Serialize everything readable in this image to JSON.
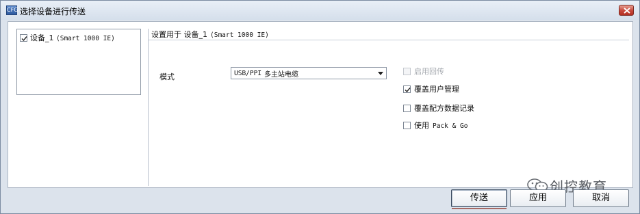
{
  "window": {
    "title": "选择设备进行传送",
    "app_icon_text": "CFG"
  },
  "device_list": {
    "items": [
      {
        "name": "设备_1",
        "type": "(Smart 1000 IE)",
        "checked": true
      }
    ]
  },
  "settings": {
    "group_title_prefix": "设置用于 设备_1",
    "group_title_type": "(Smart 1000 IE)",
    "mode_label": "模式",
    "mode_value_code": "USB/PPI",
    "mode_value_text": "多主站电缆",
    "options": [
      {
        "label": "启用回传",
        "checked": false,
        "disabled": true
      },
      {
        "label": "覆盖用户管理",
        "checked": true,
        "disabled": false
      },
      {
        "label": "覆盖配方数据记录",
        "checked": false,
        "disabled": false
      },
      {
        "label_prefix": "使用",
        "label_mono": "Pack & Go",
        "checked": false,
        "disabled": false
      }
    ]
  },
  "buttons": {
    "transfer": "传送",
    "apply": "应用",
    "cancel": "取消"
  },
  "watermark": {
    "text": "创控教育",
    "icon": "wechat-icon"
  }
}
